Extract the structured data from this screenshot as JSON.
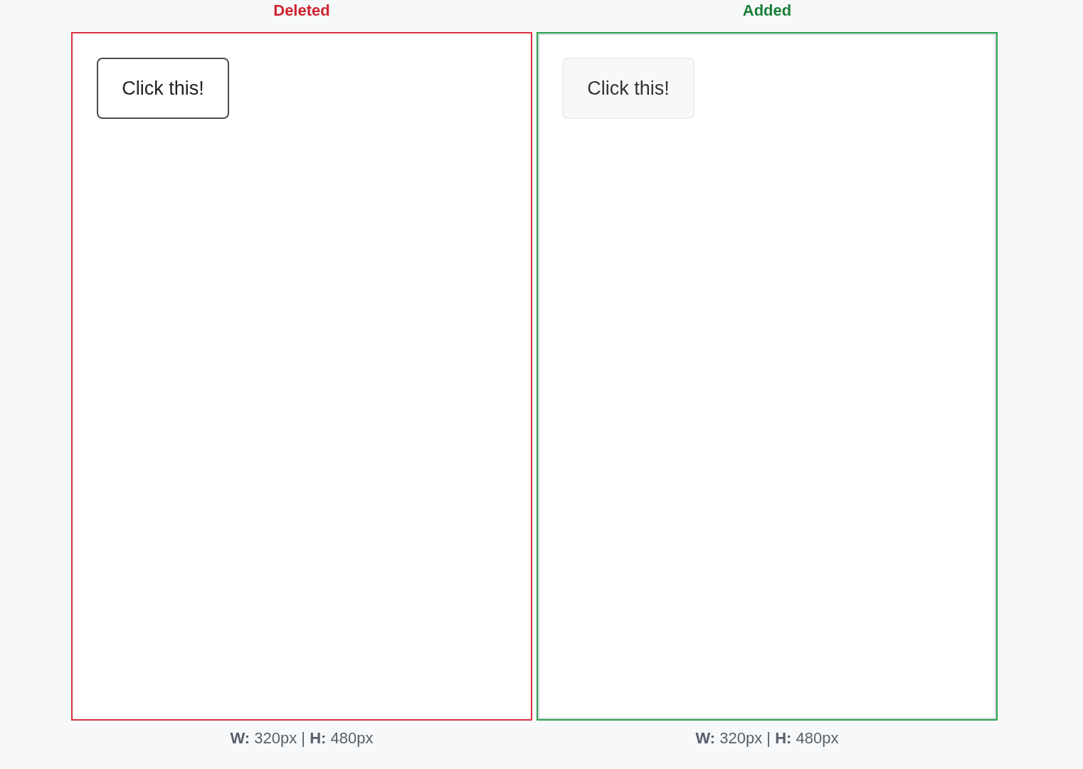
{
  "panels": [
    {
      "kind": "deleted",
      "heading": "Deleted",
      "button": {
        "label": "Click this!",
        "kind": "outlined"
      },
      "caption": "**W:** 320px | **H:** 480px"
    },
    {
      "kind": "added",
      "heading": "Added",
      "button": {
        "label": "Click this!",
        "kind": "flat"
      },
      "caption": "**W:** 320px | **H:** 480px"
    }
  ]
}
